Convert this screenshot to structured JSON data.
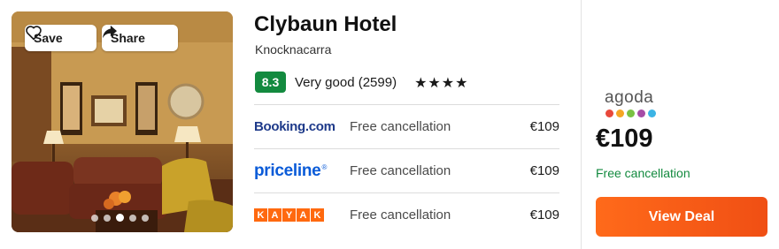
{
  "photo": {
    "save_label": "Save",
    "share_label": "Share",
    "icons": {
      "save": "heart-icon",
      "share": "share-arrow-icon"
    },
    "carousel_dots": 5,
    "active_dot": 3
  },
  "hotel": {
    "name": "Clybaun Hotel",
    "location": "Knocknacarra",
    "rating_score": "8.3",
    "rating_text": "Very good (2599)",
    "stars": "★★★★"
  },
  "offers": [
    {
      "provider": "Booking.com",
      "cancellation": "Free cancellation",
      "price": "€109"
    },
    {
      "provider": "priceline",
      "cancellation": "Free cancellation",
      "price": "€109"
    },
    {
      "provider": "KAYAK",
      "cancellation": "Free cancellation",
      "price": "€109"
    }
  ],
  "featured_deal": {
    "provider": "agoda",
    "price": "€109",
    "cancellation": "Free cancellation",
    "button_label": "View Deal"
  },
  "colors": {
    "rating_badge": "#138a3f",
    "free_cancellation_green": "#138a3f",
    "cta_orange": "#ff6a1a",
    "kayak_orange": "#ff690f",
    "booking_blue": "#1e3a8a",
    "priceline_blue": "#0a5bd8",
    "agoda_dots": [
      "#e8483b",
      "#f5a623",
      "#7ac143",
      "#a64ca6",
      "#3cb4e5"
    ]
  }
}
